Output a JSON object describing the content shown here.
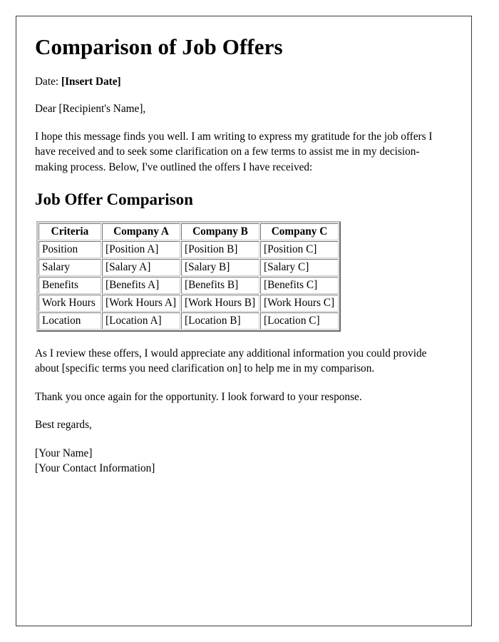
{
  "document": {
    "title": "Comparison of Job Offers",
    "date_label": "Date:",
    "date_value": "[Insert Date]",
    "salutation": "Dear [Recipient's Name],",
    "intro_paragraph": "I hope this message finds you well. I am writing to express my gratitude for the job offers I have received and to seek some clarification on a few terms to assist me in my decision-making process. Below, I've outlined the offers I have received:",
    "section_heading": "Job Offer Comparison",
    "closing_paragraph_1": "As I review these offers, I would appreciate any additional information you could provide about [specific terms you need clarification on] to help me in my comparison.",
    "closing_paragraph_2": "Thank you once again for the opportunity. I look forward to your response.",
    "sign_off": "Best regards,",
    "signature_name": "[Your Name]",
    "signature_contact": "[Your Contact Information]"
  },
  "table": {
    "headers": [
      "Criteria",
      "Company A",
      "Company B",
      "Company C"
    ],
    "rows": [
      [
        "Position",
        "[Position A]",
        "[Position B]",
        "[Position C]"
      ],
      [
        "Salary",
        "[Salary A]",
        "[Salary B]",
        "[Salary C]"
      ],
      [
        "Benefits",
        "[Benefits A]",
        "[Benefits B]",
        "[Benefits C]"
      ],
      [
        "Work Hours",
        "[Work Hours A]",
        "[Work Hours B]",
        "[Work Hours C]"
      ],
      [
        "Location",
        "[Location A]",
        "[Location B]",
        "[Location C]"
      ]
    ]
  },
  "colors": {
    "page_border": "#3a3a3a",
    "text": "#000000",
    "background": "#ffffff",
    "table_border": "#c8c8c8"
  }
}
